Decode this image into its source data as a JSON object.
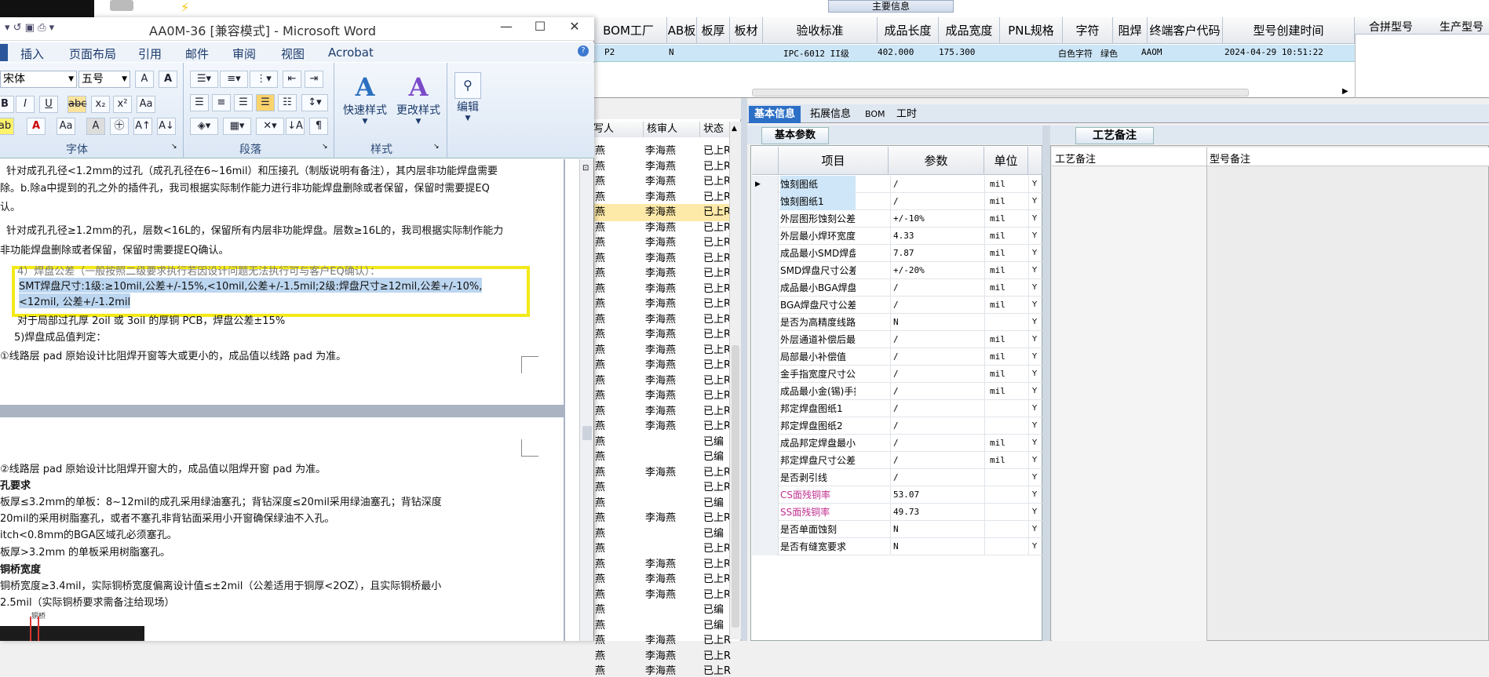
{
  "word": {
    "title": "AA0M-36 [兼容模式] - Microsoft Word",
    "window_buttons": {
      "minimize": "—",
      "maximize": "☐",
      "close": "✕"
    },
    "menu": [
      "插入",
      "页面布局",
      "引用",
      "邮件",
      "审阅",
      "视图",
      "Acrobat"
    ],
    "font_name": "宋体",
    "font_size": "五号",
    "group_labels": {
      "font": "字体",
      "paragraph": "段落",
      "styles": "样式"
    },
    "big_buttons": {
      "quick_styles": "快速样式",
      "change_styles": "更改样式",
      "edit": "编辑"
    },
    "doc_lines": [
      "针对成孔孔径<1.2mm的过孔（成孔孔径在6~16mil）和压接孔（制版说明有备注），其内层非功能焊盘需要",
      "除。b.除a中提到的孔之外的插件孔，我司根据实际制作能力进行非功能焊盘删除或者保留，保留时需要提EQ",
      "认。",
      "针对成孔孔径≥1.2mm的孔，层数<16L的，保留所有内层非功能焊盘。层数≥16L的，我司根据实际制作能力",
      "非功能焊盘删除或者保留，保留时需要提EQ确认。",
      "4）焊盘公差（一般按照二级要求执行若因设计问题无法执行可与客户EQ确认）：",
      "SMT焊盘尺寸:1级:≥10mil,公差+/-15%,<10mil,公差+/-1.5mil;2级:焊盘尺寸≥12mil,公差+/-10%,",
      "<12mil, 公差+/-1.2mil",
      "对于局部过孔厚 2oil 或 3oil 的厚铜 PCB，焊盘公差±15%",
      "5)焊盘成品值判定：",
      "①线路层 pad 原始设计比阻焊开窗等大或更小的，成品值以线路 pad 为准。"
    ],
    "doc_lines_page2": [
      "②线路层 pad 原始设计比阻焊开窗大的，成品值以阻焊开窗 pad 为准。",
      "孔要求",
      "板厚≤3.2mm的单板：8~12mil的成孔采用绿油塞孔；背钻深度≤20mil采用绿油塞孔；背钻深度",
      "20mil的采用树脂塞孔，或者不塞孔非背钻面采用小开窗确保绿油不入孔。",
      "itch<0.8mm的BGA区域孔必须塞孔。",
      "板厚>3.2mm 的单板采用树脂塞孔。",
      "铜桥宽度",
      "铜桥宽度≥3.4mil，实际铜桥宽度偏离设计值≤±2mil（公差适用于铜厚<2OZ），且实际铜桥最小",
      "2.5mil（实际铜桥要求需备注给现场）"
    ],
    "figure_label": "铜桥"
  },
  "erp": {
    "main_info_header": "主要信息",
    "columns": [
      "BOM工厂",
      "AB板",
      "板厚",
      "板材",
      "验收标准",
      "成品长度",
      "成品宽度",
      "PNL规格",
      "字符",
      "阻焊",
      "终端客户代码",
      "型号创建时间"
    ],
    "right_columns": [
      "合拼型号",
      "生产型号"
    ],
    "selected_row": {
      "bom": "P2",
      "ab": "N",
      "standard": "IPC-6012 II级",
      "length": "402.000",
      "width": "175.300",
      "char": "白色字符",
      "mask": "绿色",
      "customer": "AAOM",
      "created": "2024-04-29 10:51:22"
    },
    "list_headers": [
      "写人",
      "核审人",
      "状态"
    ],
    "list_rows": [
      [
        "燕",
        "李海燕",
        "已上R"
      ],
      [
        "燕",
        "李海燕",
        "已上R"
      ],
      [
        "燕",
        "李海燕",
        "已上R"
      ],
      [
        "燕",
        "李海燕",
        "已上R"
      ],
      [
        "燕",
        "李海燕",
        "已上R"
      ],
      [
        "燕",
        "李海燕",
        "已上R"
      ],
      [
        "燕",
        "李海燕",
        "已上R"
      ],
      [
        "燕",
        "李海燕",
        "已上R"
      ],
      [
        "燕",
        "李海燕",
        "已上R"
      ],
      [
        "燕",
        "李海燕",
        "已上R"
      ],
      [
        "燕",
        "李海燕",
        "已上R"
      ],
      [
        "燕",
        "李海燕",
        "已上R"
      ],
      [
        "燕",
        "李海燕",
        "已上R"
      ],
      [
        "燕",
        "李海燕",
        "已上R"
      ],
      [
        "燕",
        "李海燕",
        "已上R"
      ],
      [
        "燕",
        "李海燕",
        "已上R"
      ],
      [
        "燕",
        "李海燕",
        "已上R"
      ],
      [
        "燕",
        "李海燕",
        "已上R"
      ],
      [
        "燕",
        "李海燕",
        "已上R"
      ],
      [
        "燕",
        "",
        "已编"
      ],
      [
        "燕",
        "",
        "已编"
      ],
      [
        "燕",
        "李海燕",
        "已上R"
      ],
      [
        "燕",
        "",
        "已上R"
      ],
      [
        "燕",
        "",
        "已编"
      ],
      [
        "燕",
        "李海燕",
        "已上R"
      ],
      [
        "燕",
        "",
        "已编"
      ],
      [
        "燕",
        "",
        "已上R"
      ],
      [
        "燕",
        "李海燕",
        "已上R"
      ],
      [
        "燕",
        "李海燕",
        "已上R"
      ],
      [
        "燕",
        "李海燕",
        "已上R"
      ],
      [
        "燕",
        "",
        "已编"
      ],
      [
        "燕",
        "",
        "已编"
      ],
      [
        "燕",
        "李海燕",
        "已上R"
      ],
      [
        "燕",
        "李海燕",
        "已上R"
      ],
      [
        "燕",
        "李海燕",
        "已上R"
      ]
    ],
    "tabs": [
      "基本信息",
      "拓展信息",
      "BOM",
      "工时"
    ],
    "subtab": "基本参数",
    "param_headers": [
      "项目",
      "参数",
      "单位"
    ],
    "params": [
      [
        "蚀刻图纸",
        "/",
        "mil",
        "Y"
      ],
      [
        "蚀刻图纸1",
        "/",
        "mil",
        "Y"
      ],
      [
        "外层图形蚀刻公差",
        "+/-10%",
        "mil",
        "Y"
      ],
      [
        "外层最小焊环宽度",
        "4.33",
        "mil",
        "Y"
      ],
      [
        "成品最小SMD焊盘宽度",
        "7.87",
        "mil",
        "Y"
      ],
      [
        "SMD焊盘尺寸公差",
        "+/-20%",
        "mil",
        "Y"
      ],
      [
        "成品最小BGA焊盘尺寸",
        "/",
        "mil",
        "Y"
      ],
      [
        "BGA焊盘尺寸公差",
        "/",
        "mil",
        "Y"
      ],
      [
        "是否为高精度线路",
        "N",
        "",
        "Y"
      ],
      [
        "外层通道补偿后最小宽度",
        "/",
        "mil",
        "Y"
      ],
      [
        "局部最小补偿值",
        "/",
        "mil",
        "Y"
      ],
      [
        "金手指宽度尺寸公差",
        "/",
        "mil",
        "Y"
      ],
      [
        "成品最小金(锡)手指宽度",
        "/",
        "mil",
        "Y"
      ],
      [
        "邦定焊盘图纸1",
        "/",
        "",
        "Y"
      ],
      [
        "邦定焊盘图纸2",
        "/",
        "",
        "Y"
      ],
      [
        "成品邦定焊盘最小宽度",
        "/",
        "mil",
        "Y"
      ],
      [
        "邦定焊盘尺寸公差",
        "/",
        "mil",
        "Y"
      ],
      [
        "是否剥引线",
        "/",
        "",
        "Y"
      ],
      [
        "CS面残铜率",
        "53.07",
        "",
        "Y"
      ],
      [
        "SS面残铜率",
        "49.73",
        "",
        "Y"
      ],
      [
        "是否单面蚀刻",
        "N",
        "",
        "Y"
      ],
      [
        "是否有缝宽要求",
        "N",
        "",
        "Y"
      ]
    ],
    "right_tab": "工艺备注",
    "right_headers": [
      "工艺备注",
      "型号备注"
    ]
  }
}
